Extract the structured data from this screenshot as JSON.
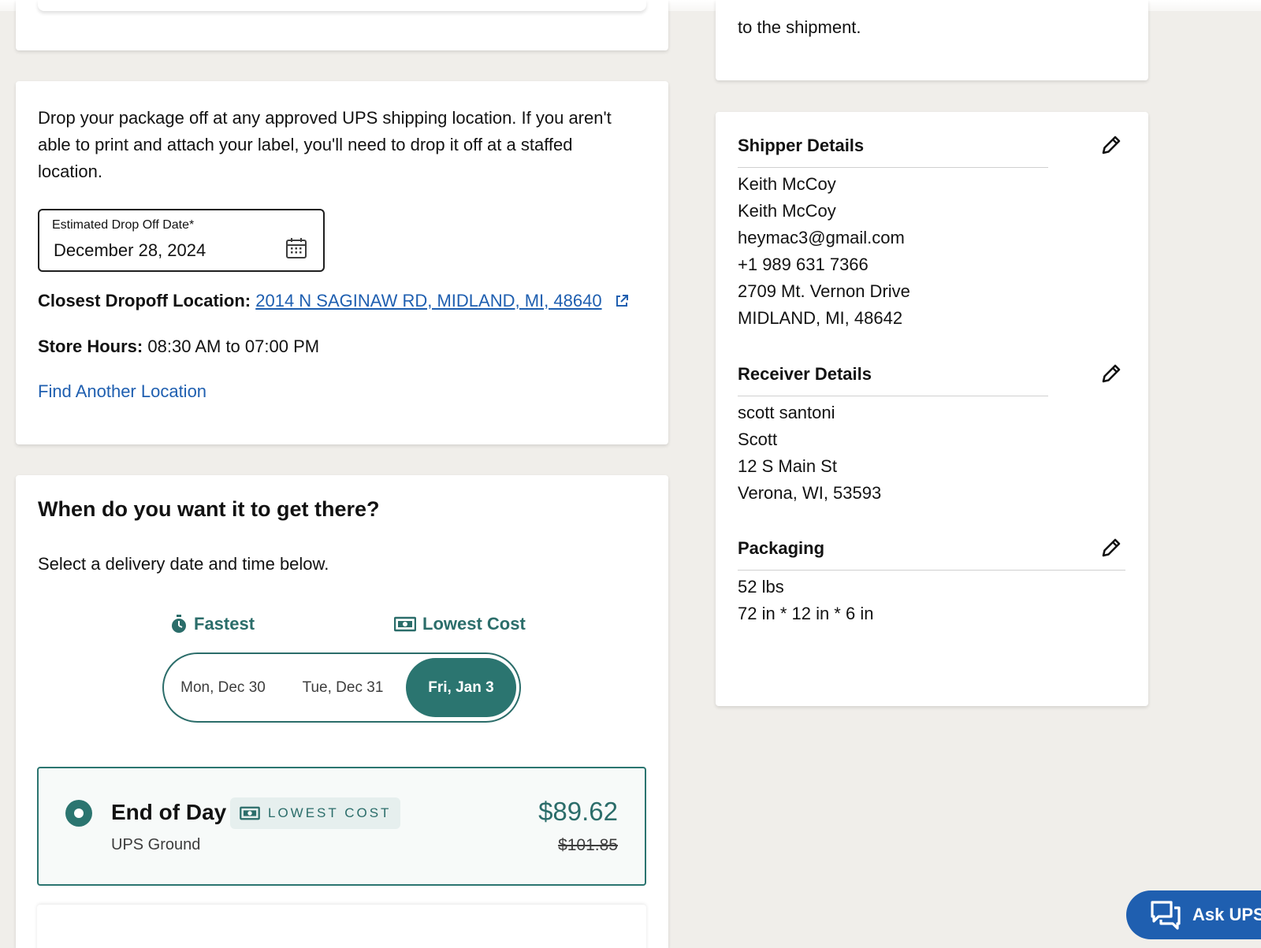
{
  "right_top": {
    "text": "to the shipment."
  },
  "dropoff": {
    "description": "Drop your package off at any approved UPS shipping location. If you aren't able to print and attach your label, you'll need to drop it off at a staffed location.",
    "date_label": "Estimated Drop Off Date*",
    "date_value": "December 28, 2024",
    "closest_label": "Closest Dropoff Location:",
    "closest_value": "2014 N SAGINAW RD, MIDLAND, MI, 48640",
    "hours_label": "Store Hours:",
    "hours_value": "08:30 AM to 07:00 PM",
    "find_another": "Find Another Location"
  },
  "delivery": {
    "title": "When do you want it to get there?",
    "subtitle": "Select a delivery date and time below.",
    "fastest_label": "Fastest",
    "lowest_label": "Lowest Cost",
    "dates": [
      "Mon, Dec 30",
      "Tue, Dec 31",
      "Fri, Jan 3"
    ],
    "selected_date": "Fri, Jan 3",
    "service": {
      "name": "End of Day",
      "badge": "LOWEST COST",
      "type": "UPS Ground",
      "price": "$89.62",
      "old_price": "$101.85"
    }
  },
  "shipper": {
    "title": "Shipper Details",
    "lines": [
      "Keith McCoy",
      "Keith McCoy",
      "heymac3@gmail.com",
      "+1 989 631 7366",
      "2709 Mt. Vernon Drive",
      "MIDLAND, MI, 48642"
    ]
  },
  "receiver": {
    "title": "Receiver Details",
    "lines": [
      "scott santoni",
      "Scott",
      "12 S Main St",
      "Verona, WI, 53593"
    ]
  },
  "packaging": {
    "title": "Packaging",
    "lines": [
      "52 lbs",
      "72 in * 12 in * 6 in"
    ]
  },
  "ask": {
    "label": "Ask UPS"
  },
  "colors": {
    "accent": "#2b7570",
    "link": "#1f5fb0",
    "background": "#f0eeea"
  }
}
